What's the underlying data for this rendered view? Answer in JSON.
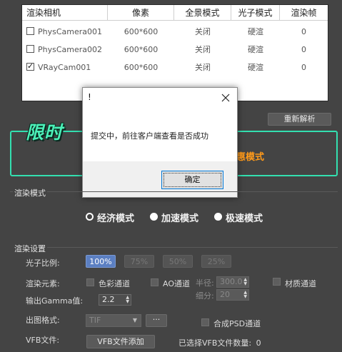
{
  "table": {
    "headers": [
      "渲染相机",
      "像素",
      "全景模式",
      "光子模式",
      "渲染帧"
    ],
    "rows": [
      {
        "checked": false,
        "camera": "PhysCamera001",
        "pixels": "600*600",
        "panorama": "关闭",
        "photon": "硬渲",
        "frame": "0"
      },
      {
        "checked": false,
        "camera": "PhysCamera002",
        "pixels": "600*600",
        "panorama": "关闭",
        "photon": "硬渲",
        "frame": "0"
      },
      {
        "checked": true,
        "camera": "VRayCam001",
        "pixels": "600*600",
        "panorama": "关闭",
        "photon": "硬渲",
        "frame": "0"
      }
    ]
  },
  "reparse_button": "重新解析",
  "promo": {
    "badge_text": "限时",
    "mode_text": "惠模式"
  },
  "dialog": {
    "title": "!",
    "message": "提交中，前往客户端查看是否成功",
    "ok_label": "确定"
  },
  "render_mode": {
    "label": "渲染模式",
    "options": [
      {
        "label": "经济模式",
        "selected": true
      },
      {
        "label": "加速模式",
        "selected": false
      },
      {
        "label": "极速模式",
        "selected": false
      }
    ]
  },
  "render_settings": {
    "label": "渲染设置",
    "photon_ratio_label": "光子比例:",
    "photon_ratios": [
      "100%",
      "75%",
      "50%",
      "25%"
    ],
    "active_ratio": "100%",
    "elements_label": "渲染元素:",
    "color_channel": "色彩通道",
    "ao_channel": "AO通道",
    "radius_label": "半径:",
    "radius_value": "300.0",
    "subdiv_label": "细分:",
    "subdiv_value": "20",
    "material_channel": "材质通道",
    "gamma_label": "输出Gamma值:",
    "gamma_value": "2.2",
    "format_label": "出图格式:",
    "format_value": "TIF",
    "more_button": "···",
    "psd_label": "合成PSD通道",
    "vfb_label": "VFB文件:",
    "vfb_add_button": "VFB文件添加",
    "vfb_count_label": "已选择VFB文件数量:",
    "vfb_count": "0"
  },
  "colors": {
    "accent_teal": "#33e0b0",
    "promo_orange": "#ff9a1a",
    "active_blue": "#5b7fc2"
  }
}
